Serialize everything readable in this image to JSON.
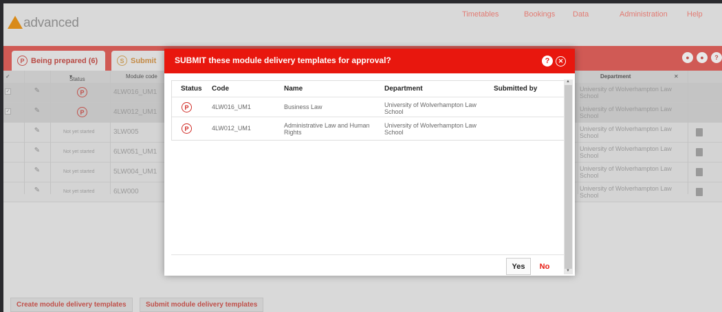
{
  "brand": {
    "logo_text": "advanced",
    "accent": "#e8170e"
  },
  "nav": {
    "items": [
      "Timetables",
      "Bookings",
      "Data",
      "Administration",
      "Help"
    ]
  },
  "tabs": [
    {
      "letter": "P",
      "label": "Being prepared (6)"
    },
    {
      "letter": "S",
      "label": "Submit"
    }
  ],
  "table": {
    "headers": {
      "status": "Status",
      "module_code": "Module code",
      "department": "Department"
    },
    "rows": [
      {
        "status": "P",
        "code": "4LW016_UM1",
        "dept": "University of Wolverhampton Law School"
      },
      {
        "status": "P",
        "code": "4LW012_UM1",
        "dept": "University of Wolverhampton Law School"
      },
      {
        "status": "Not yet started",
        "code": "3LW005",
        "dept": "University of Wolverhampton Law School"
      },
      {
        "status": "Not yet started",
        "code": "6LW051_UM1",
        "dept": "University of Wolverhampton Law School"
      },
      {
        "status": "Not yet started",
        "code": "5LW004_UM1",
        "dept": "University of Wolverhampton Law School"
      },
      {
        "status": "Not yet started",
        "code": "6LW000",
        "dept": "University of Wolverhampton Law School"
      }
    ]
  },
  "bottom_buttons": {
    "create": "Create module delivery templates",
    "submit": "Submit module delivery templates"
  },
  "modal": {
    "title": "SUBMIT these module delivery templates for approval?",
    "headers": {
      "status": "Status",
      "code": "Code",
      "name": "Name",
      "department": "Department",
      "submitted_by": "Submitted by"
    },
    "rows": [
      {
        "status": "P",
        "code": "4LW016_UM1",
        "name": "Business Law",
        "department": "University of Wolverhampton Law School",
        "submitted_by": ""
      },
      {
        "status": "P",
        "code": "4LW012_UM1",
        "name": "Administrative Law and Human Rights",
        "department": "University of Wolverhampton Law School",
        "submitted_by": ""
      }
    ],
    "yes_label": "Yes",
    "no_label": "No"
  }
}
